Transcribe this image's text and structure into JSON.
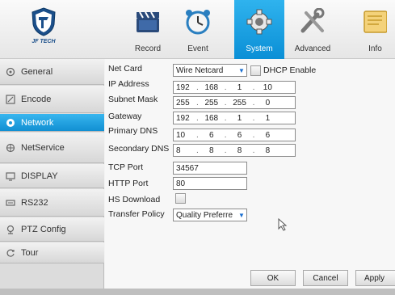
{
  "brand": "JF TECH",
  "tabs": [
    {
      "label": "Record",
      "icon": "clapperboard-icon"
    },
    {
      "label": "Event",
      "icon": "alarm-clock-icon"
    },
    {
      "label": "System",
      "icon": "gear-icon"
    },
    {
      "label": "Advanced",
      "icon": "tools-icon"
    },
    {
      "label": "Info",
      "icon": "info-icon"
    }
  ],
  "active_tab": "System",
  "sidebar": {
    "items": [
      {
        "label": "General",
        "icon": "general-icon"
      },
      {
        "label": "Encode",
        "icon": "encode-icon"
      },
      {
        "label": "Network",
        "icon": "network-icon"
      },
      {
        "label": "NetService",
        "icon": "netservice-icon"
      },
      {
        "label": "DISPLAY",
        "icon": "display-icon"
      },
      {
        "label": "RS232",
        "icon": "rs232-icon"
      },
      {
        "label": "PTZ Config",
        "icon": "ptz-icon"
      },
      {
        "label": "Tour",
        "icon": "tour-icon"
      }
    ],
    "active": "Network"
  },
  "form": {
    "net_card_label": "Net Card",
    "net_card_value": "Wire Netcard",
    "dhcp_label": "DHCP Enable",
    "ip_label": "IP Address",
    "ip": [
      "192",
      "168",
      "1",
      "10"
    ],
    "mask_label": "Subnet Mask",
    "mask": [
      "255",
      "255",
      "255",
      "0"
    ],
    "gateway_label": "Gateway",
    "gateway": [
      "192",
      "168",
      "1",
      "1"
    ],
    "dns1_label": "Primary DNS",
    "dns1": [
      "10",
      "6",
      "6",
      "6"
    ],
    "dns2_label": "Secondary DNS",
    "dns2": [
      "8",
      "8",
      "8",
      "8"
    ],
    "tcp_label": "TCP Port",
    "tcp_value": "34567",
    "http_label": "HTTP Port",
    "http_value": "80",
    "hs_label": "HS Download",
    "policy_label": "Transfer Policy",
    "policy_value": "Quality Preferre"
  },
  "buttons": {
    "ok": "OK",
    "cancel": "Cancel",
    "apply": "Apply"
  },
  "colors": {
    "accent": "#1aa0e3",
    "brand": "#1b4f8a"
  }
}
